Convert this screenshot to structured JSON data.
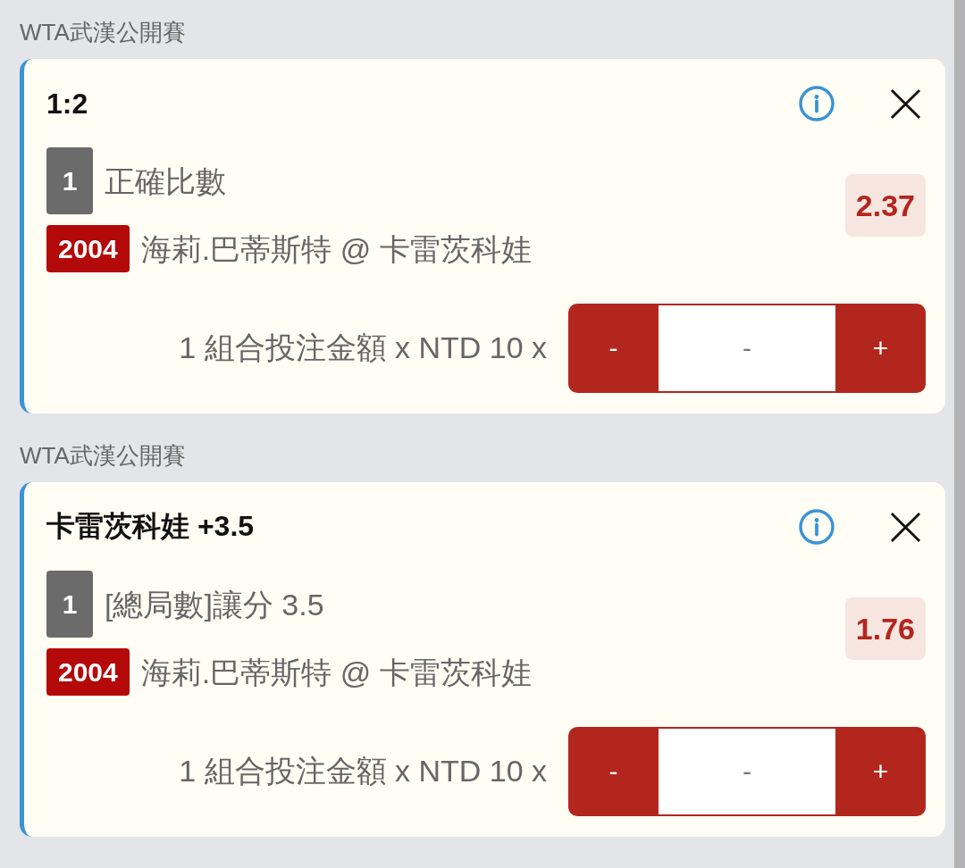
{
  "bets": [
    {
      "competition": "WTA武漢公開賽",
      "title": "1:2",
      "bet_count": "1",
      "market": "正確比數",
      "event_code": "2004",
      "match": "海莉.巴蒂斯特 @ 卡雷茨科娃",
      "odds": "2.37",
      "stake_label": "1 組合投注金額 x NTD 10 x",
      "stepper": {
        "decrement": "-",
        "placeholder": "-",
        "increment": "+"
      }
    },
    {
      "competition": "WTA武漢公開賽",
      "title": "卡雷茨科娃 +3.5",
      "bet_count": "1",
      "market": "[總局數]讓分 3.5",
      "event_code": "2004",
      "match": "海莉.巴蒂斯特 @ 卡雷茨科娃",
      "odds": "1.76",
      "stake_label": "1 組合投注金額 x NTD 10 x",
      "stepper": {
        "decrement": "-",
        "placeholder": "-",
        "increment": "+"
      }
    }
  ]
}
